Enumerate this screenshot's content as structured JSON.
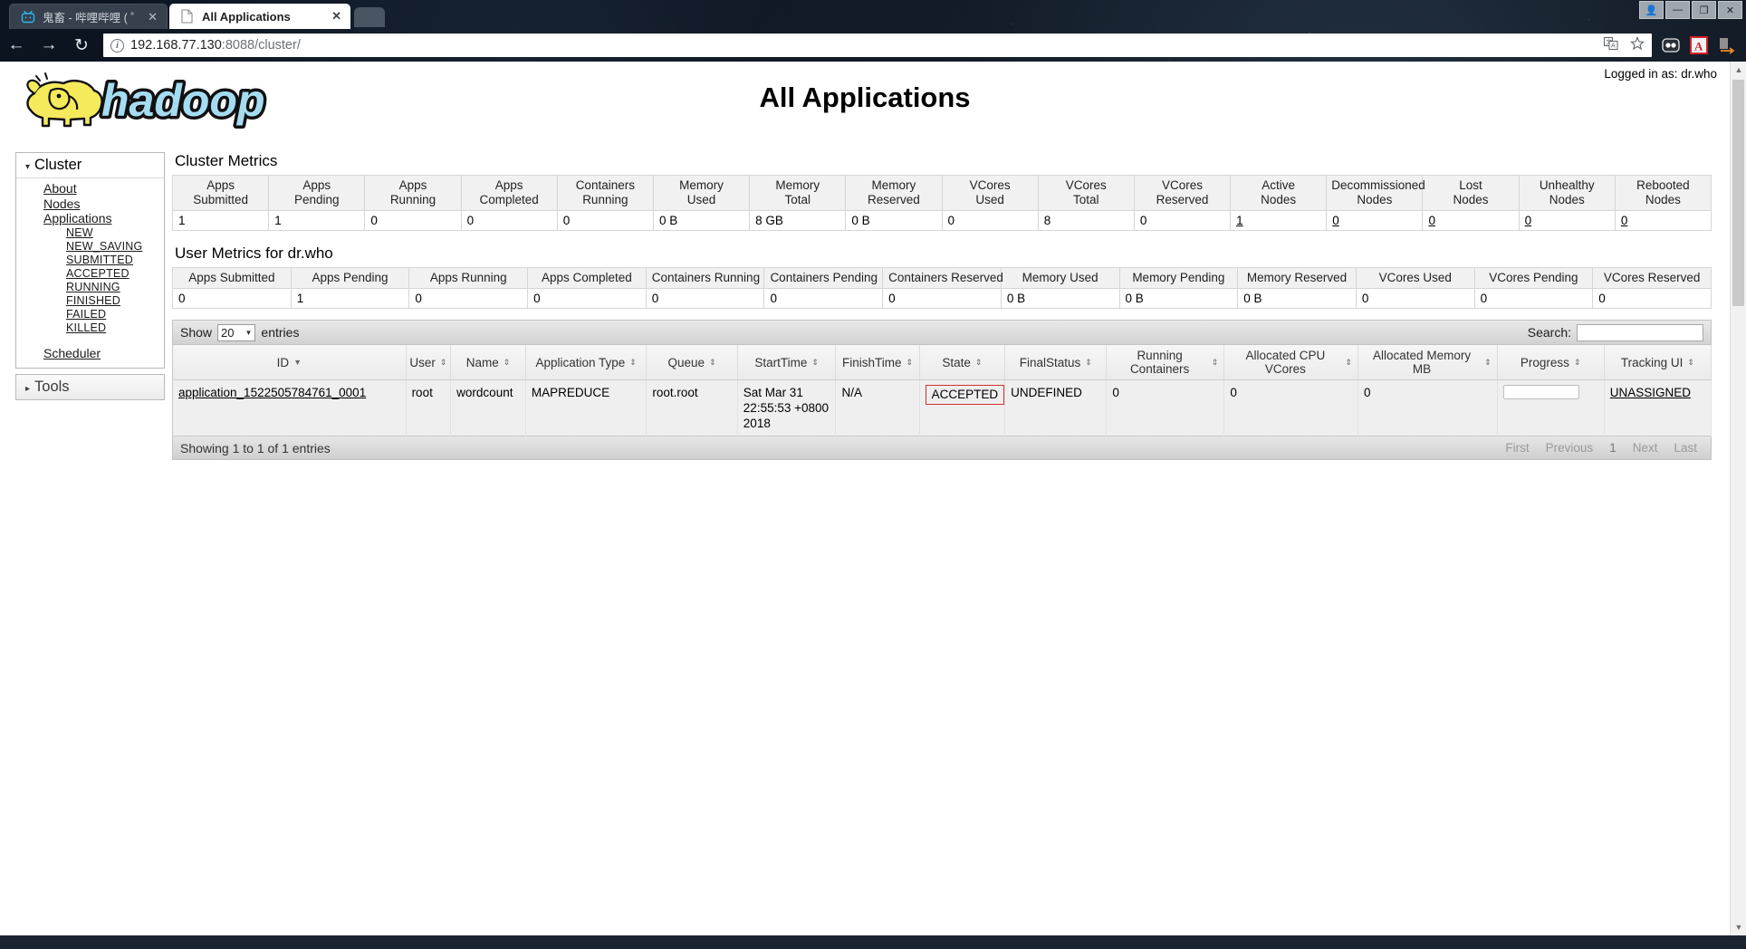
{
  "browser": {
    "tabs": [
      {
        "label": "鬼畜 - 哔哩哔哩 ( ゜- ゜)つ",
        "close": "✕",
        "favicon": "bilibili-icon",
        "active": false
      },
      {
        "label": "All Applications",
        "close": "✕",
        "favicon": "page-icon",
        "active": true
      }
    ],
    "window_controls": [
      {
        "name": "profile-button",
        "glyph": "👤"
      },
      {
        "name": "minimize-button",
        "glyph": "—"
      },
      {
        "name": "maximize-button",
        "glyph": "❐"
      },
      {
        "name": "close-button",
        "glyph": "✕"
      }
    ],
    "nav": {
      "back": "←",
      "forward": "→",
      "reload": "↻"
    },
    "omnibox": {
      "info_glyph": "i",
      "url_host": "192.168.77.130",
      "url_rest": ":8088/cluster/",
      "translate_icon": "translate-icon",
      "bookmark_icon": "star-icon"
    },
    "extensions": [
      {
        "name": "lastpass-extension-icon",
        "glyph": "●●"
      },
      {
        "name": "adobe-acrobat-extension-icon",
        "glyph": "A"
      },
      {
        "name": "download-extension-icon",
        "glyph": "→"
      }
    ]
  },
  "page": {
    "logged_in_label": "Logged in as: dr.who",
    "title": "All Applications",
    "logo_alt": "hadoop"
  },
  "sidebar": {
    "cluster": {
      "header": "Cluster",
      "caret": "▾",
      "items": [
        {
          "label": "About",
          "level": 1
        },
        {
          "label": "Nodes",
          "level": 1
        },
        {
          "label": "Applications",
          "level": 1
        },
        {
          "label": "NEW",
          "level": 2
        },
        {
          "label": "NEW_SAVING",
          "level": 2
        },
        {
          "label": "SUBMITTED",
          "level": 2
        },
        {
          "label": "ACCEPTED",
          "level": 2
        },
        {
          "label": "RUNNING",
          "level": 2
        },
        {
          "label": "FINISHED",
          "level": 2
        },
        {
          "label": "FAILED",
          "level": 2
        },
        {
          "label": "KILLED",
          "level": 2
        },
        {
          "label": "Scheduler",
          "level": 1,
          "spaced": true
        }
      ]
    },
    "tools": {
      "header": "Tools",
      "caret": "▸"
    }
  },
  "cluster_metrics": {
    "title": "Cluster Metrics",
    "columns": [
      "Apps\nSubmitted",
      "Apps\nPending",
      "Apps\nRunning",
      "Apps\nCompleted",
      "Containers\nRunning",
      "Memory\nUsed",
      "Memory\nTotal",
      "Memory\nReserved",
      "VCores\nUsed",
      "VCores\nTotal",
      "VCores\nReserved",
      "Active\nNodes",
      "Decommissioned\nNodes",
      "Lost\nNodes",
      "Unhealthy\nNodes",
      "Rebooted\nNodes"
    ],
    "values": [
      "1",
      "1",
      "0",
      "0",
      "0",
      "0 B",
      "8 GB",
      "0 B",
      "0",
      "8",
      "0",
      "1",
      "0",
      "0",
      "0",
      "0"
    ],
    "linked": [
      false,
      false,
      false,
      false,
      false,
      false,
      false,
      false,
      false,
      false,
      false,
      true,
      true,
      true,
      true,
      true
    ]
  },
  "user_metrics": {
    "title": "User Metrics for dr.who",
    "columns": [
      "Apps Submitted",
      "Apps Pending",
      "Apps Running",
      "Apps Completed",
      "Containers Running",
      "Containers Pending",
      "Containers Reserved",
      "Memory Used",
      "Memory Pending",
      "Memory Reserved",
      "VCores Used",
      "VCores Pending",
      "VCores Reserved"
    ],
    "values": [
      "0",
      "1",
      "0",
      "0",
      "0",
      "0",
      "0",
      "0 B",
      "0 B",
      "0 B",
      "0",
      "0",
      "0"
    ]
  },
  "datatable": {
    "show_label": "Show",
    "entries_label": "entries",
    "page_length": "20",
    "select_arrow": "▼",
    "search_label": "Search:",
    "search_value": "",
    "search_placeholder": "",
    "columns": [
      {
        "label": "ID",
        "sort": "desc"
      },
      {
        "label": "User",
        "sort": "both"
      },
      {
        "label": "Name",
        "sort": "both"
      },
      {
        "label": "Application Type",
        "sort": "both"
      },
      {
        "label": "Queue",
        "sort": "both"
      },
      {
        "label": "StartTime",
        "sort": "both"
      },
      {
        "label": "FinishTime",
        "sort": "both"
      },
      {
        "label": "State",
        "sort": "both"
      },
      {
        "label": "FinalStatus",
        "sort": "both"
      },
      {
        "label": "Running Containers",
        "sort": "both"
      },
      {
        "label": "Allocated CPU VCores",
        "sort": "both"
      },
      {
        "label": "Allocated Memory MB",
        "sort": "both"
      },
      {
        "label": "Progress",
        "sort": "both"
      },
      {
        "label": "Tracking UI",
        "sort": "both"
      }
    ],
    "rows": [
      {
        "id": "application_1522505784761_0001",
        "user": "root",
        "name": "wordcount",
        "application_type": "MAPREDUCE",
        "queue": "root.root",
        "start_time": "Sat Mar 31 22:55:53 +0800 2018",
        "finish_time": "N/A",
        "state": "ACCEPTED",
        "final_status": "UNDEFINED",
        "running_containers": "0",
        "allocated_cpu_vcores": "0",
        "allocated_memory_mb": "0",
        "progress": "",
        "tracking_ui": "UNASSIGNED"
      }
    ],
    "info": "Showing 1 to 1 of 1 entries",
    "pager": [
      "First",
      "Previous",
      "1",
      "Next",
      "Last"
    ]
  },
  "colors": {
    "highlight_box": "#d03030",
    "header_bg": "#f1f1f1",
    "row_bg": "#efefef",
    "link": "#1a1a1a"
  }
}
